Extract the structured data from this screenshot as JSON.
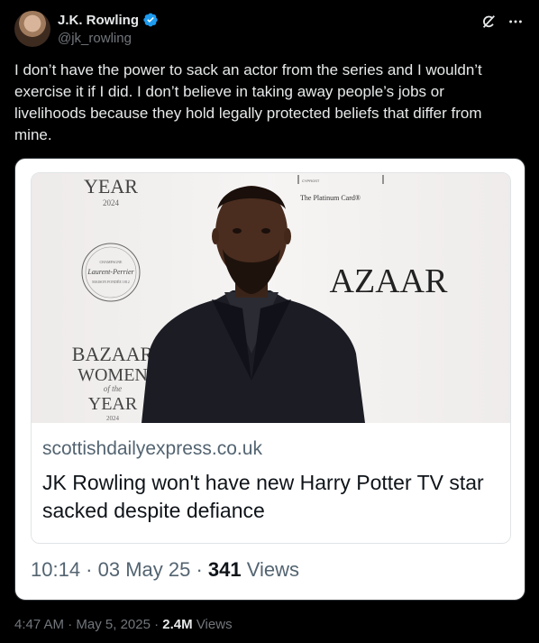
{
  "author": {
    "name": "J.K. Rowling",
    "handle": "@jk_rowling"
  },
  "tweet": {
    "text": "I don’t have the power to sack an actor from the series and I wouldn’t exercise it if I did. I don’t believe in taking away people’s jobs or livelihoods because they hold legally protected beliefs that differ from mine."
  },
  "media": {
    "photo_text": {
      "year_top": "YEAR",
      "year_top_num": "2024",
      "champagne_small": "CHAMPAGNE",
      "champagne_brand": "Laurent-Perrier",
      "champagne_sub": "MAISON FONDÉE 1812",
      "card_small": "CYPROST",
      "card_text": "The Platinum Card®",
      "bazaar_right": "AZAAR",
      "bazaar": "BAZAAR",
      "women": "WOMEN",
      "of_the": "of the",
      "year": "YEAR",
      "year_num": "2024"
    },
    "link": {
      "domain": "scottishdailyexpress.co.uk",
      "headline": "JK Rowling won't have new Harry Potter TV star sacked despite defiance"
    },
    "meta": {
      "time": "10:14",
      "date": "03 May 25",
      "views_count": "341",
      "views_label": "Views"
    }
  },
  "footer": {
    "time": "4:47 AM",
    "date": "May 5, 2025",
    "views_count": "2.4M",
    "views_label": "Views"
  },
  "colors": {
    "background": "#000000",
    "verified": "#1d9bf0",
    "muted": "#71767b"
  }
}
